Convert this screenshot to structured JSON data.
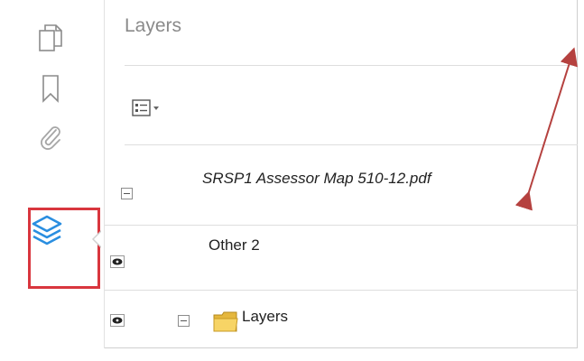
{
  "rail": {
    "icons": [
      "pages-icon",
      "bookmark-icon",
      "attachment-icon",
      "layers-icon"
    ]
  },
  "panel": {
    "title": "Layers",
    "options_icon": "layer-options-icon"
  },
  "tree": {
    "document": {
      "label": "SRSP1 Assessor Map 510-12.pdf"
    },
    "layers": [
      {
        "label": "Other 2"
      },
      {
        "label": "Layers"
      }
    ]
  },
  "colors": {
    "active_icon": "#2a8ee0",
    "highlight_box": "#d9363e",
    "arrow": "#b5413f"
  }
}
